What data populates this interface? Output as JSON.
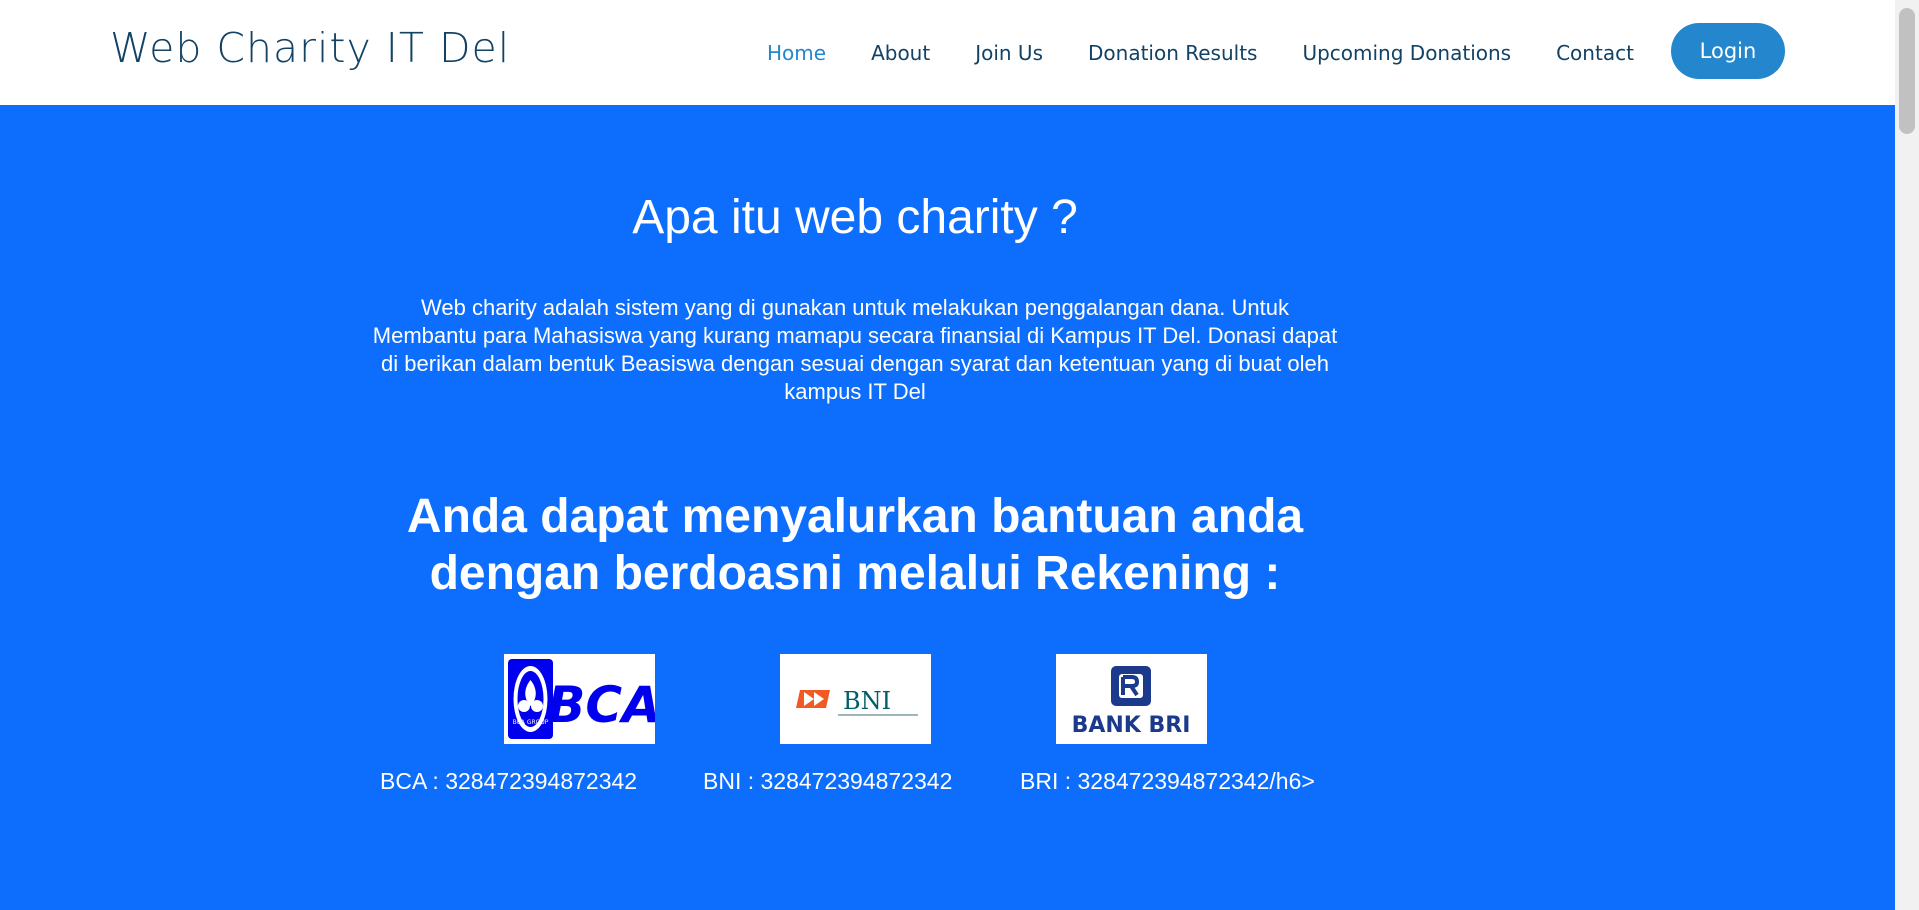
{
  "navbar": {
    "brand": "Web Charity IT Del",
    "links": [
      {
        "label": "Home",
        "active": true
      },
      {
        "label": "About"
      },
      {
        "label": "Join Us"
      },
      {
        "label": "Donation Results"
      },
      {
        "label": "Upcoming Donations"
      },
      {
        "label": "Contact"
      }
    ],
    "login_label": "Login"
  },
  "hero": {
    "title": "Apa itu web charity ?",
    "description": "Web charity adalah sistem yang di gunakan untuk melakukan penggalangan dana. Untuk Membantu para Mahasiswa yang kurang mamapu secara finansial di Kampus IT Del. Donasi dapat di berikan dalam bentuk Beasiswa dengan sesuai dengan syarat dan ketentuan yang di buat oleh kampus IT Del",
    "subtitle": "Anda dapat menyalurkan bantuan anda dengan berdoasni melalui Rekening :",
    "banks": [
      {
        "logo_text": "BCA",
        "logo_seal_text": "BCA GROUP",
        "account": "BCA : 328472394872342"
      },
      {
        "logo_text": "BNI",
        "account": "BNI : 328472394872342"
      },
      {
        "logo_text": "BANK BRI",
        "account": "BRI : 328472394872342/h6>"
      }
    ]
  },
  "colors": {
    "hero_bg": "#0d6efd",
    "brand_text": "#124265",
    "accent": "#2487ce",
    "bca_blue": "#0000ee",
    "bni_orange": "#f15a23",
    "bni_teal": "#005e6a",
    "bri_navy": "#1b3a8c"
  }
}
